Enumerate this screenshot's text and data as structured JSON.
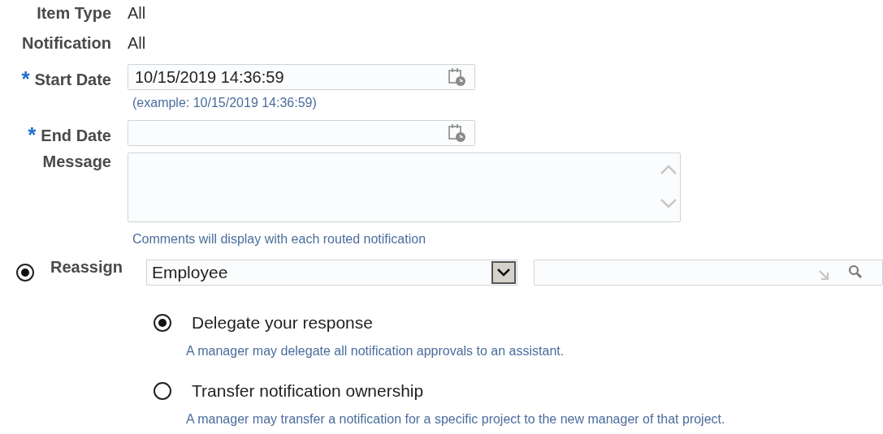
{
  "fields": [
    {
      "kind": "static",
      "label": "Item Type",
      "value": "All"
    },
    {
      "kind": "static",
      "label": "Notification",
      "value": "All"
    },
    {
      "kind": "date",
      "label": "Start Date",
      "required_mark": "*",
      "value": "10/15/2019 14:36:59",
      "hint": "(example: 10/15/2019 14:36:59)"
    },
    {
      "kind": "date",
      "label": "End Date",
      "required_mark": "*"
    },
    {
      "kind": "textarea",
      "label": "Message",
      "hint": "Comments will display with each routed notification"
    }
  ],
  "reassign": {
    "label": "Reassign",
    "selected": true,
    "type_select": {
      "value": "Employee"
    },
    "options": [
      {
        "label": "Delegate your response",
        "selected": true,
        "description": "A manager may delegate all notification approvals to an assistant."
      },
      {
        "label": "Transfer notification ownership",
        "selected": false,
        "description": "A manager may transfer a notification for a specific project to the new manager of that project."
      }
    ]
  }
}
